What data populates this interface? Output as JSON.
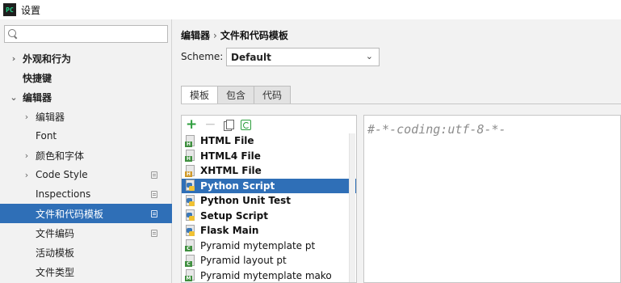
{
  "window": {
    "app_icon_text": "PC",
    "title": "设置"
  },
  "search": {
    "placeholder": "",
    "value": ""
  },
  "sidebar": {
    "items": [
      {
        "label": "外观和行为",
        "chevron": "›",
        "bold": true
      },
      {
        "label": "快捷键",
        "chevron": "",
        "bold": true
      },
      {
        "label": "编辑器",
        "chevron": "⌄",
        "bold": true
      },
      {
        "label": "编辑器",
        "chevron": "›"
      },
      {
        "label": "Font",
        "chevron": ""
      },
      {
        "label": "颜色和字体",
        "chevron": "›"
      },
      {
        "label": "Code Style",
        "chevron": "›"
      },
      {
        "label": "Inspections",
        "chevron": ""
      },
      {
        "label": "文件和代码模板",
        "chevron": ""
      },
      {
        "label": "文件编码",
        "chevron": ""
      },
      {
        "label": "活动模板",
        "chevron": ""
      },
      {
        "label": "文件类型",
        "chevron": ""
      }
    ]
  },
  "breadcrumb": {
    "parent": "编辑器",
    "separator": "›",
    "current": "文件和代码模板"
  },
  "scheme": {
    "label": "Scheme:",
    "value": "Default",
    "chevron": "⌄"
  },
  "tabs": [
    {
      "label": "模板"
    },
    {
      "label": "包含"
    },
    {
      "label": "代码"
    }
  ],
  "toolbar": {
    "add": "+",
    "remove": "−"
  },
  "templates": [
    {
      "label": "HTML File",
      "icon_tag": "H"
    },
    {
      "label": "HTML4 File",
      "icon_tag": "H"
    },
    {
      "label": "XHTML File",
      "icon_tag": "H"
    },
    {
      "label": "Python Script"
    },
    {
      "label": "Python Unit Test"
    },
    {
      "label": "Setup Script"
    },
    {
      "label": "Flask Main"
    },
    {
      "label": "Pyramid mytemplate pt",
      "icon_tag": "C"
    },
    {
      "label": "Pyramid layout pt",
      "icon_tag": "C"
    },
    {
      "label": "Pyramid mytemplate mako",
      "icon_tag": "M"
    }
  ],
  "editor": {
    "content": "#-*-coding:utf-8-*-"
  },
  "colors": {
    "selection": "#2f6fb7",
    "add_green": "#2e9e3e"
  }
}
